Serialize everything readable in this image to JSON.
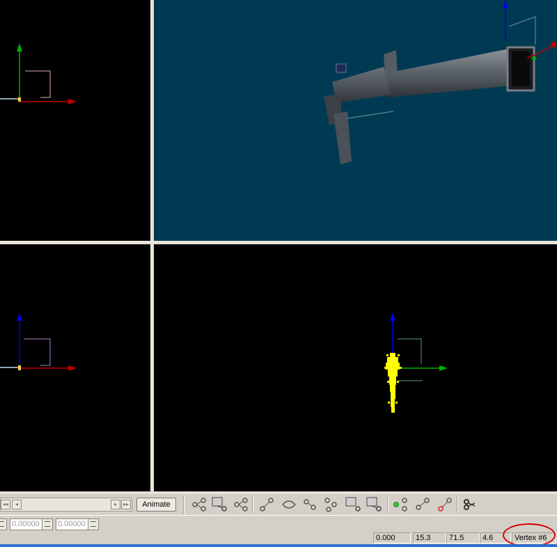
{
  "viewports": {
    "top_left": {
      "view": "orthographic-side",
      "background": "#000000"
    },
    "top_right": {
      "view": "perspective-3d",
      "background": "#003a52",
      "model": "submachine-gun"
    },
    "bottom_left": {
      "view": "orthographic-side",
      "background": "#000000"
    },
    "bottom_right": {
      "view": "orthographic-front",
      "background": "#000000",
      "selection_color": "#ffff00"
    }
  },
  "timeline": {
    "buttons": [
      "rewind-icon",
      "step-back-icon",
      "step-forward-icon",
      "fast-forward-icon"
    ]
  },
  "toolbar": {
    "animate_label": "Animate",
    "tools": [
      "bone-icon",
      "select-bone-icon",
      "bone-link-icon",
      "move-joint-icon",
      "rotate-joint-icon",
      "link-vertex-icon",
      "unlink-vertex-icon",
      "select-vertex-icon",
      "select-joint-icon",
      "assign-vertex-icon",
      "unassign-vertex-icon",
      "paint-weight-icon",
      "split-icon"
    ]
  },
  "inputs": {
    "fields": [
      {
        "value": ""
      },
      {
        "value": "0.00000"
      },
      {
        "value": "0.00000"
      }
    ]
  },
  "status": {
    "field1": "0.000",
    "field2": "15.3",
    "field3": "71.5",
    "field4": "4.6",
    "selection": "Vertex #6"
  },
  "colors": {
    "axis_x": "#c00000",
    "axis_y": "#00b000",
    "axis_z": "#0000e0",
    "accent_ring": "#d60000"
  }
}
